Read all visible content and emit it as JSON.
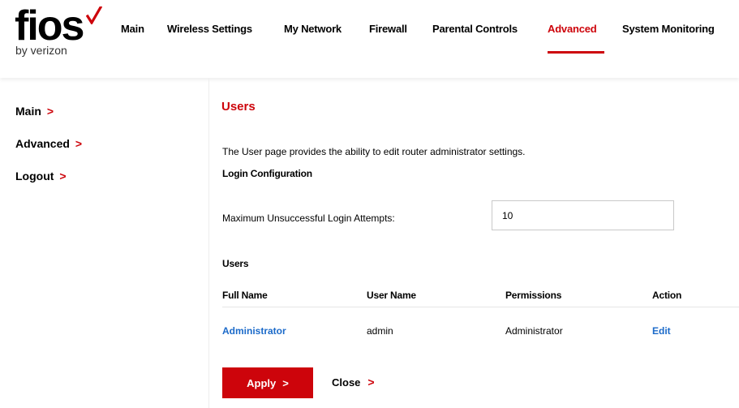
{
  "brand": {
    "logo_text": "fios",
    "logo_sub": "by verizon",
    "accent_color": "#cd040b",
    "link_color": "#1b6ac9"
  },
  "nav": {
    "items": [
      {
        "label": "Main"
      },
      {
        "label": "Wireless Settings"
      },
      {
        "label": "My Network"
      },
      {
        "label": "Firewall"
      },
      {
        "label": "Parental Controls"
      },
      {
        "label": "Advanced",
        "active": true
      },
      {
        "label": "System Monitoring"
      }
    ]
  },
  "sidebar": {
    "items": [
      {
        "label": "Main"
      },
      {
        "label": "Advanced"
      },
      {
        "label": "Logout"
      }
    ],
    "chevron_icon": "chevron-right-icon"
  },
  "page": {
    "title": "Users",
    "description": "The User page provides the ability to edit router administrator settings.",
    "login_config_heading": "Login Configuration",
    "max_attempts_label": "Maximum Unsuccessful Login Attempts:",
    "max_attempts_value": "10",
    "users_heading": "Users",
    "table": {
      "headers": [
        "Full Name",
        "User Name",
        "Permissions",
        "Action"
      ],
      "rows": [
        {
          "full_name": "Administrator",
          "user_name": "admin",
          "permissions": "Administrator",
          "action": "Edit"
        }
      ]
    },
    "apply_label": "Apply",
    "close_label": "Close"
  }
}
